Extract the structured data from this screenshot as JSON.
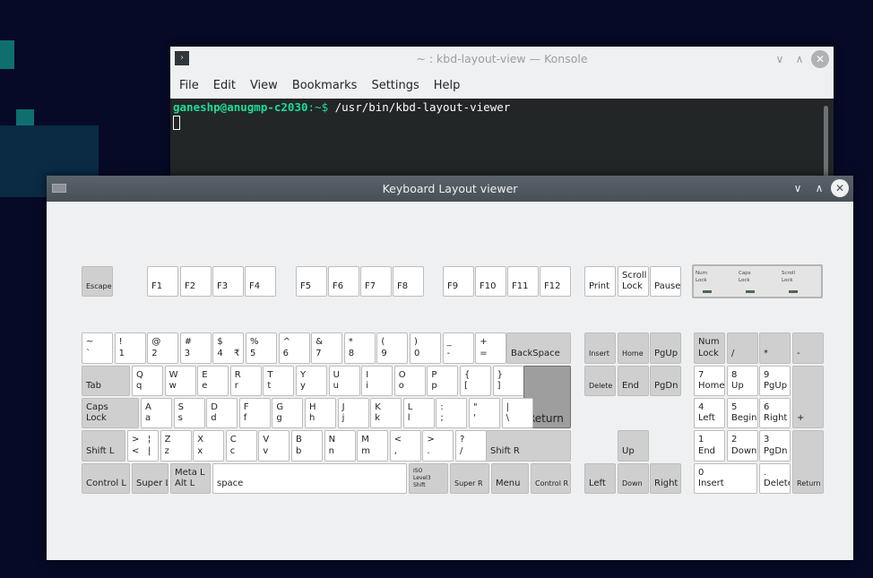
{
  "konsole": {
    "title": "~ : kbd-layout-view — Konsole",
    "menu": [
      "File",
      "Edit",
      "View",
      "Bookmarks",
      "Settings",
      "Help"
    ],
    "prompt_user": "ganeshp@anugmp-c2030",
    "prompt_path": ":~$",
    "command": " /usr/bin/kbd-layout-viewer"
  },
  "viewer": {
    "title": "Keyboard Layout viewer",
    "leds": [
      {
        "label": "Num\nLock",
        "color": "#4b6a4b"
      },
      {
        "label": "Caps\nLock",
        "color": "#4b6a4b"
      },
      {
        "label": "Scroll\nLock",
        "color": "#4b6a4b"
      }
    ],
    "keys": [
      {
        "t": "",
        "b": "Escape",
        "s": "mod small"
      },
      {
        "t": "",
        "b": "F1"
      },
      {
        "t": "",
        "b": "F2"
      },
      {
        "t": "",
        "b": "F3"
      },
      {
        "t": "",
        "b": "F4"
      },
      {
        "t": "",
        "b": "F5"
      },
      {
        "t": "",
        "b": "F6"
      },
      {
        "t": "",
        "b": "F7"
      },
      {
        "t": "",
        "b": "F8"
      },
      {
        "t": "",
        "b": "F9"
      },
      {
        "t": "",
        "b": "F10"
      },
      {
        "t": "",
        "b": "F11"
      },
      {
        "t": "",
        "b": "F12"
      },
      {
        "t": "",
        "b": "Print"
      },
      {
        "t": "Scroll",
        "b": "Lock"
      },
      {
        "t": "",
        "b": "Pause"
      },
      {
        "t": "~",
        "b": "`"
      },
      {
        "t": "!",
        "b": "1"
      },
      {
        "t": "@",
        "b": "2"
      },
      {
        "t": "#",
        "b": "3"
      },
      {
        "t": "$",
        "b": "4",
        "r": "₹"
      },
      {
        "t": "%",
        "b": "5"
      },
      {
        "t": "^",
        "b": "6"
      },
      {
        "t": "&",
        "b": "7"
      },
      {
        "t": "*",
        "b": "8"
      },
      {
        "t": "(",
        "b": "9"
      },
      {
        "t": ")",
        "b": "0"
      },
      {
        "t": "_",
        "b": "-"
      },
      {
        "t": "+",
        "b": "="
      },
      {
        "t": "",
        "b": "BackSpace",
        "s": "mod"
      },
      {
        "t": "",
        "b": "Tab",
        "s": "mod"
      },
      {
        "t": "Q",
        "b": "q"
      },
      {
        "t": "W",
        "b": "w"
      },
      {
        "t": "E",
        "b": "e"
      },
      {
        "t": "R",
        "b": "r"
      },
      {
        "t": "T",
        "b": "t"
      },
      {
        "t": "Y",
        "b": "y"
      },
      {
        "t": "U",
        "b": "u"
      },
      {
        "t": "I",
        "b": "i"
      },
      {
        "t": "O",
        "b": "o"
      },
      {
        "t": "P",
        "b": "p"
      },
      {
        "t": "{",
        "b": "["
      },
      {
        "t": "}",
        "b": "]"
      },
      {
        "t": "",
        "b": "Return",
        "s": "dark"
      },
      {
        "t": "Caps",
        "b": "Lock",
        "s": "mod"
      },
      {
        "t": "A",
        "b": "a"
      },
      {
        "t": "S",
        "b": "s"
      },
      {
        "t": "D",
        "b": "d"
      },
      {
        "t": "F",
        "b": "f"
      },
      {
        "t": "G",
        "b": "g"
      },
      {
        "t": "H",
        "b": "h"
      },
      {
        "t": "J",
        "b": "j"
      },
      {
        "t": "K",
        "b": "k"
      },
      {
        "t": "L",
        "b": "l"
      },
      {
        "t": ":",
        "b": ";"
      },
      {
        "t": "\"",
        "b": "'"
      },
      {
        "t": "|",
        "b": "\\"
      },
      {
        "t": "",
        "b": "Shift L",
        "s": "mod"
      },
      {
        "t": ">   ¦",
        "b": "<   |"
      },
      {
        "t": "Z",
        "b": "z"
      },
      {
        "t": "X",
        "b": "x"
      },
      {
        "t": "C",
        "b": "c"
      },
      {
        "t": "V",
        "b": "v"
      },
      {
        "t": "B",
        "b": "b"
      },
      {
        "t": "N",
        "b": "n"
      },
      {
        "t": "M",
        "b": "m"
      },
      {
        "t": "<",
        "b": ","
      },
      {
        "t": ">",
        "b": "."
      },
      {
        "t": "?",
        "b": "/"
      },
      {
        "t": "",
        "b": "Shift R",
        "s": "mod"
      },
      {
        "t": "",
        "b": "Control L",
        "s": "mod"
      },
      {
        "t": "",
        "b": "Super L",
        "s": "mod"
      },
      {
        "t": "Meta L",
        "b": "Alt L",
        "s": "mod"
      },
      {
        "t": "",
        "b": "space"
      },
      {
        "t": "ISO\nLevel3\nShift",
        "b": "",
        "s": "mod tiny"
      },
      {
        "t": "",
        "b": "Super R",
        "s": "mod small"
      },
      {
        "t": "",
        "b": "Menu",
        "s": "mod"
      },
      {
        "t": "",
        "b": "Control R",
        "s": "mod small"
      },
      {
        "t": "",
        "b": "Insert",
        "s": "mod small"
      },
      {
        "t": "",
        "b": "Home",
        "s": "mod small"
      },
      {
        "t": "",
        "b": "PgUp",
        "s": "mod"
      },
      {
        "t": "",
        "b": "Delete",
        "s": "mod small"
      },
      {
        "t": "",
        "b": "End",
        "s": "mod"
      },
      {
        "t": "",
        "b": "PgDn",
        "s": "mod"
      },
      {
        "t": "",
        "b": "Up",
        "s": "mod"
      },
      {
        "t": "",
        "b": "Left",
        "s": "mod"
      },
      {
        "t": "",
        "b": "Down",
        "s": "mod small"
      },
      {
        "t": "",
        "b": "Right",
        "s": "mod"
      },
      {
        "t": "Num",
        "b": "Lock",
        "s": "mod"
      },
      {
        "t": "",
        "b": "/",
        "s": "mod"
      },
      {
        "t": "",
        "b": "*",
        "s": "mod"
      },
      {
        "t": "",
        "b": "-",
        "s": "mod"
      },
      {
        "t": "7",
        "b": "Home"
      },
      {
        "t": "8",
        "b": "Up"
      },
      {
        "t": "9",
        "b": "PgUp"
      },
      {
        "t": "",
        "b": "+",
        "s": "mod"
      },
      {
        "t": "4",
        "b": "Left"
      },
      {
        "t": "5",
        "b": "Begin"
      },
      {
        "t": "6",
        "b": "Right"
      },
      {
        "t": "1",
        "b": "End"
      },
      {
        "t": "2",
        "b": "Down"
      },
      {
        "t": "3",
        "b": "PgDn"
      },
      {
        "t": "",
        "b": "Return",
        "s": "mod small"
      },
      {
        "t": "0",
        "b": "Insert"
      },
      {
        "t": ".",
        "b": "Delete"
      }
    ]
  }
}
